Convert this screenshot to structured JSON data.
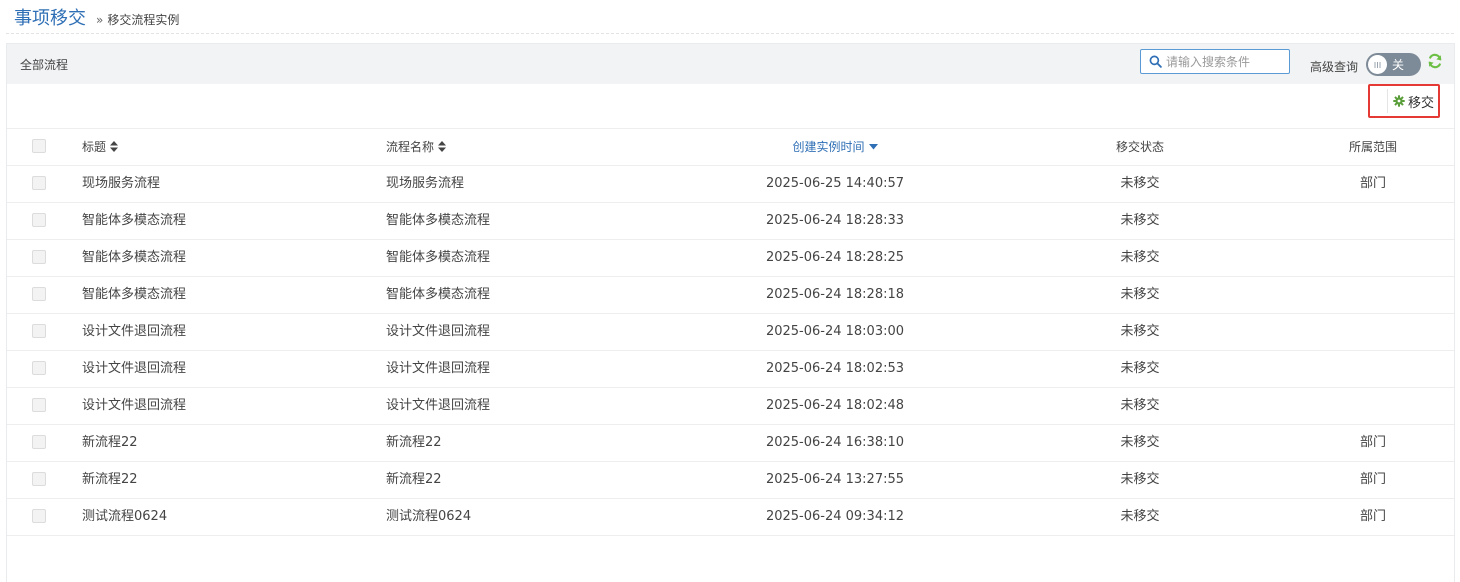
{
  "header": {
    "title": "事项移交",
    "separator": "»",
    "breadcrumb": "移交流程实例"
  },
  "panel": {
    "title": "全部流程",
    "search_placeholder": "请输入搜索条件",
    "search_icon": "search-icon",
    "advanced_label": "高级查询",
    "toggle_label": "关",
    "refresh_icon": "refresh-icon"
  },
  "toolbar": {
    "transfer_label": "移交",
    "transfer_icon": "gear-icon"
  },
  "colors": {
    "accent": "#2f6fb5",
    "gear": "#5a9e3a",
    "refresh": "#6cbf45",
    "highlight": "#e53935",
    "toggle_bg": "#7d8a97"
  },
  "table": {
    "columns": {
      "title": "标题",
      "flow": "流程名称",
      "time": "创建实例时间",
      "status": "移交状态",
      "scope": "所属范围"
    },
    "sorted_by": "创建实例时间",
    "sort_direction": "desc",
    "rows": [
      {
        "title": "现场服务流程",
        "flow": "现场服务流程",
        "time": "2025-06-25 14:40:57",
        "status": "未移交",
        "scope": "部门"
      },
      {
        "title": "智能体多模态流程",
        "flow": "智能体多模态流程",
        "time": "2025-06-24 18:28:33",
        "status": "未移交",
        "scope": ""
      },
      {
        "title": "智能体多模态流程",
        "flow": "智能体多模态流程",
        "time": "2025-06-24 18:28:25",
        "status": "未移交",
        "scope": ""
      },
      {
        "title": "智能体多模态流程",
        "flow": "智能体多模态流程",
        "time": "2025-06-24 18:28:18",
        "status": "未移交",
        "scope": ""
      },
      {
        "title": "设计文件退回流程",
        "flow": "设计文件退回流程",
        "time": "2025-06-24 18:03:00",
        "status": "未移交",
        "scope": ""
      },
      {
        "title": "设计文件退回流程",
        "flow": "设计文件退回流程",
        "time": "2025-06-24 18:02:53",
        "status": "未移交",
        "scope": ""
      },
      {
        "title": "设计文件退回流程",
        "flow": "设计文件退回流程",
        "time": "2025-06-24 18:02:48",
        "status": "未移交",
        "scope": ""
      },
      {
        "title": "新流程22",
        "flow": "新流程22",
        "time": "2025-06-24 16:38:10",
        "status": "未移交",
        "scope": "部门"
      },
      {
        "title": "新流程22",
        "flow": "新流程22",
        "time": "2025-06-24 13:27:55",
        "status": "未移交",
        "scope": "部门"
      },
      {
        "title": "测试流程0624",
        "flow": "测试流程0624",
        "time": "2025-06-24 09:34:12",
        "status": "未移交",
        "scope": "部门"
      }
    ]
  }
}
